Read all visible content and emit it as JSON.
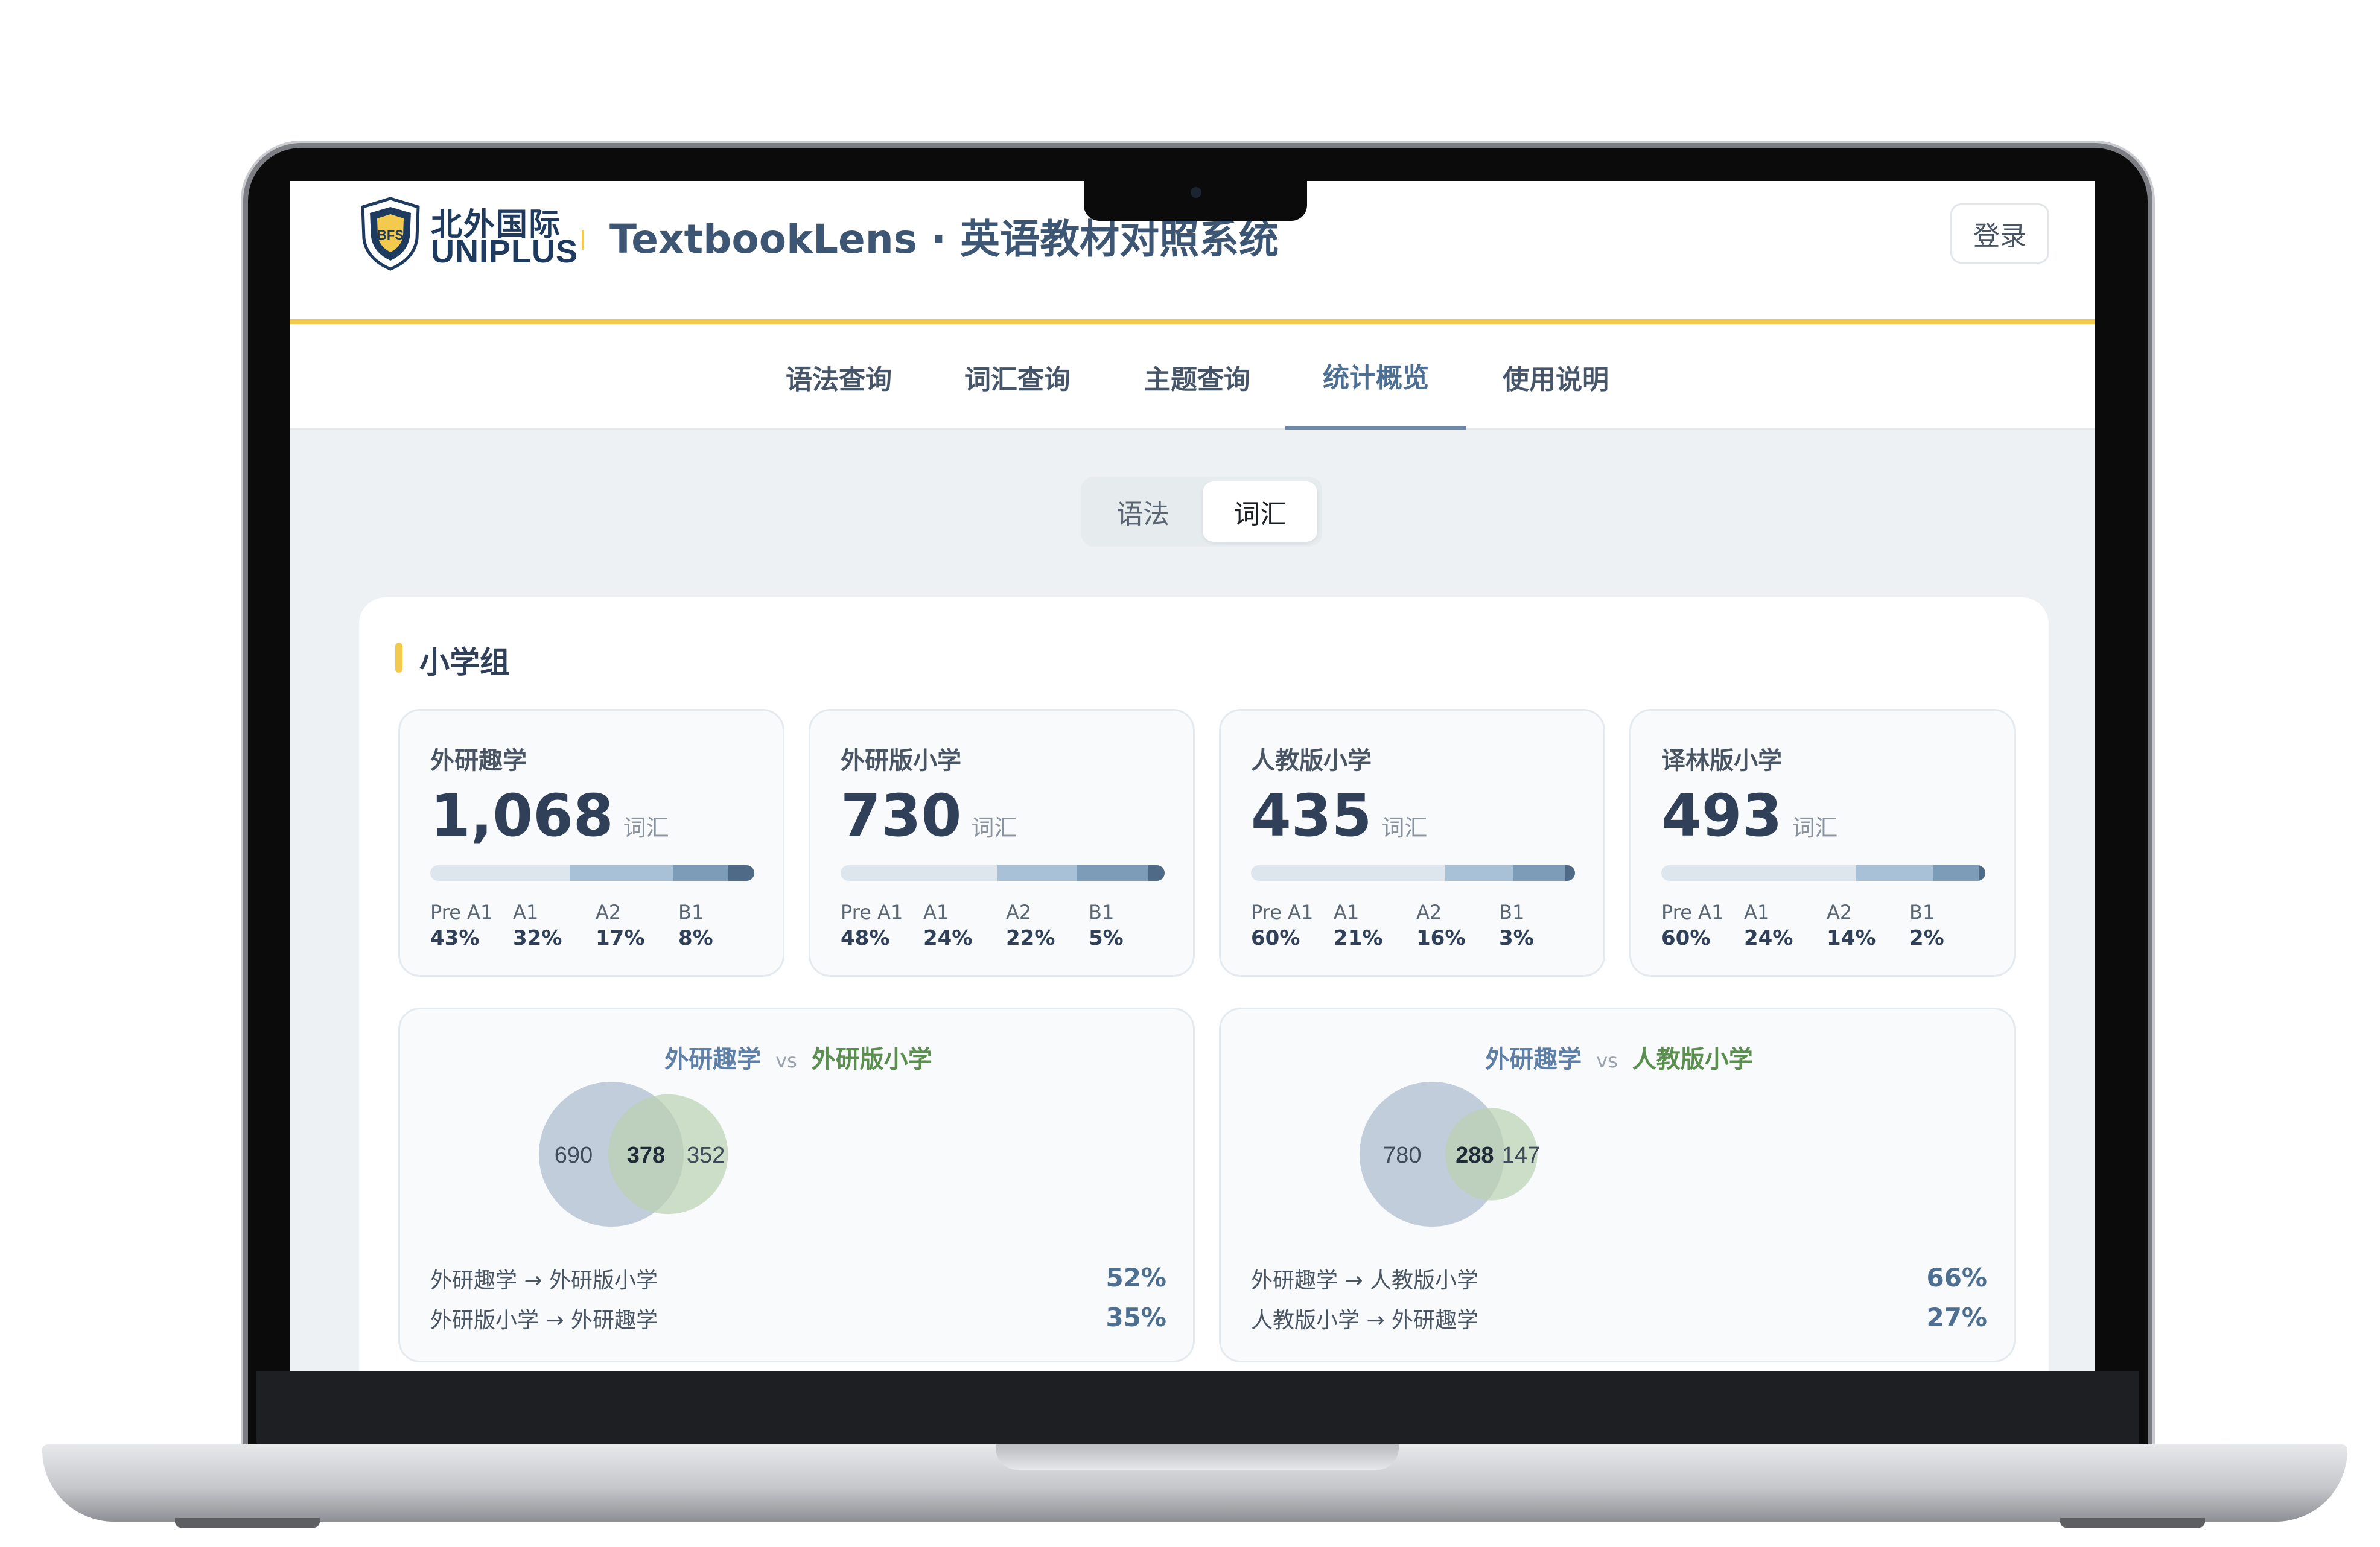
{
  "app": {
    "logo_cn": "北外国际",
    "logo_en": "UNIPLUS",
    "title": "TextbookLens · 英语教材对照系统",
    "login_label": "登录"
  },
  "nav": {
    "items": [
      {
        "label": "语法查询"
      },
      {
        "label": "词汇查询"
      },
      {
        "label": "主题查询"
      },
      {
        "label": "统计概览"
      },
      {
        "label": "使用说明"
      }
    ],
    "active": "统计概览"
  },
  "toggle": {
    "options": [
      "语法",
      "词汇"
    ],
    "selected": "词汇"
  },
  "section": {
    "title": "小学组"
  },
  "textbooks": [
    {
      "name": "外研趣学",
      "count": "1,068",
      "unit": "词汇",
      "levels": [
        {
          "label": "Pre A1",
          "pct": "43%",
          "value": 43
        },
        {
          "label": "A1",
          "pct": "32%",
          "value": 32
        },
        {
          "label": "A2",
          "pct": "17%",
          "value": 17
        },
        {
          "label": "B1",
          "pct": "8%",
          "value": 8
        }
      ]
    },
    {
      "name": "外研版小学",
      "count": "730",
      "unit": "词汇",
      "levels": [
        {
          "label": "Pre A1",
          "pct": "48%",
          "value": 48
        },
        {
          "label": "A1",
          "pct": "24%",
          "value": 24
        },
        {
          "label": "A2",
          "pct": "22%",
          "value": 22
        },
        {
          "label": "B1",
          "pct": "5%",
          "value": 5
        }
      ]
    },
    {
      "name": "人教版小学",
      "count": "435",
      "unit": "词汇",
      "levels": [
        {
          "label": "Pre A1",
          "pct": "60%",
          "value": 60
        },
        {
          "label": "A1",
          "pct": "21%",
          "value": 21
        },
        {
          "label": "A2",
          "pct": "16%",
          "value": 16
        },
        {
          "label": "B1",
          "pct": "3%",
          "value": 3
        }
      ]
    },
    {
      "name": "译林版小学",
      "count": "493",
      "unit": "词汇",
      "levels": [
        {
          "label": "Pre A1",
          "pct": "60%",
          "value": 60
        },
        {
          "label": "A1",
          "pct": "24%",
          "value": 24
        },
        {
          "label": "A2",
          "pct": "14%",
          "value": 14
        },
        {
          "label": "B1",
          "pct": "2%",
          "value": 2
        }
      ]
    }
  ],
  "level_colors": [
    "#dde6ec",
    "#a9c1d6",
    "#7d9cb7",
    "#4f6a86"
  ],
  "comparisons": [
    {
      "a": "外研趣学",
      "vs": "vs",
      "b": "外研版小学",
      "only_a": 690,
      "shared": 378,
      "only_b": 352,
      "rows": [
        {
          "label": "外研趣学 → 外研版小学",
          "pct": "52%"
        },
        {
          "label": "外研版小学 → 外研趣学",
          "pct": "35%"
        }
      ]
    },
    {
      "a": "外研趣学",
      "vs": "vs",
      "b": "人教版小学",
      "only_a": 780,
      "shared": 288,
      "only_b": 147,
      "rows": [
        {
          "label": "外研趣学 → 人教版小学",
          "pct": "66%"
        },
        {
          "label": "人教版小学 → 外研趣学",
          "pct": "27%"
        }
      ]
    }
  ],
  "colors": {
    "accent_yellow": "#f3c94e",
    "venn_a": "#a9b9cd",
    "venn_b": "#b9d2b0"
  }
}
